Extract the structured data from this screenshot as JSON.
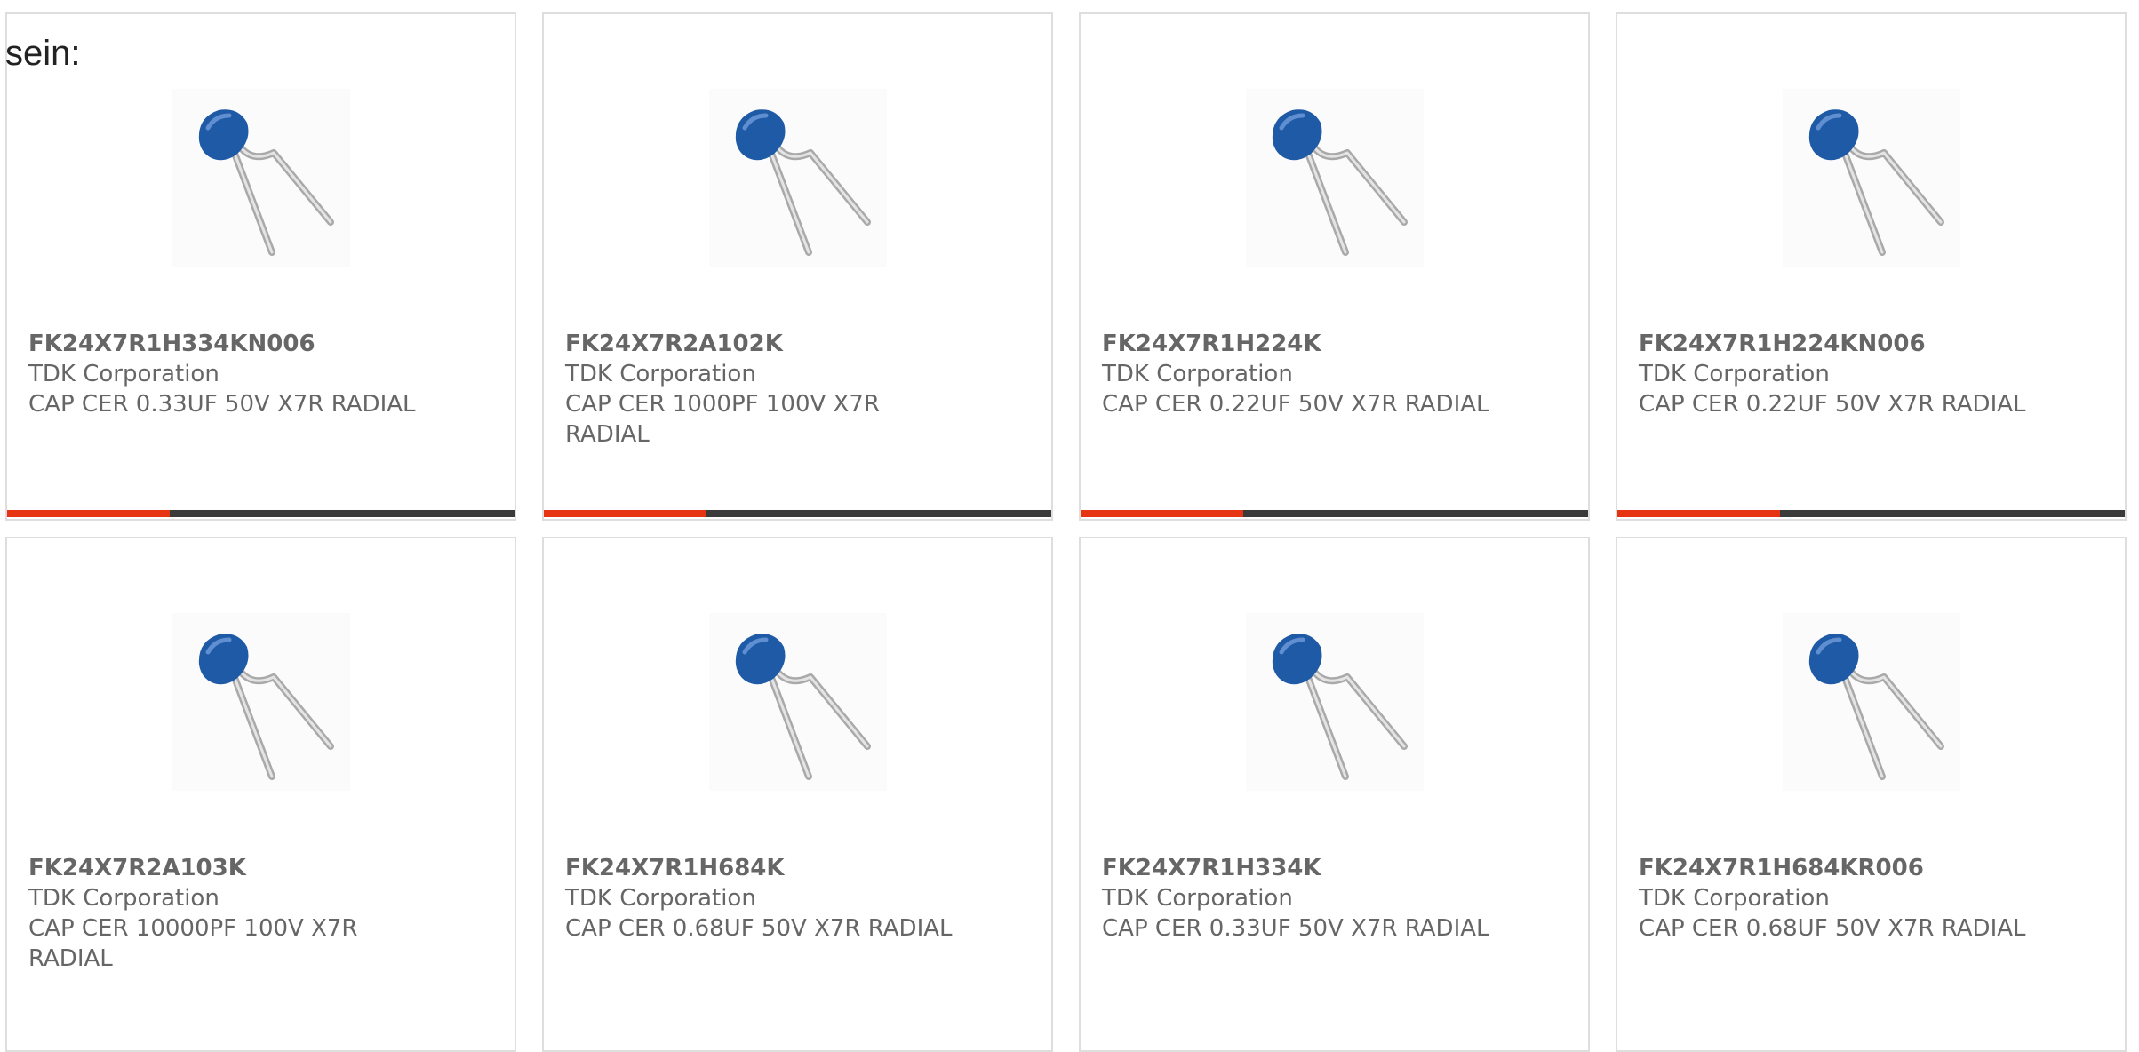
{
  "intro_text": "sein:",
  "colors": {
    "accent": "#e63312",
    "bar_track": "#3a3a3a",
    "capacitor_body": "#1f5aa6"
  },
  "products": [
    {
      "part_number": "FK24X7R1H334KN006",
      "manufacturer": "TDK Corporation",
      "description": "CAP CER 0.33UF 50V X7R RADIAL",
      "image_icon": "ceramic-capacitor-icon",
      "progress": 0.32
    },
    {
      "part_number": "FK24X7R2A102K",
      "manufacturer": "TDK Corporation",
      "description": "CAP CER 1000PF 100V X7R RADIAL",
      "image_icon": "ceramic-capacitor-icon",
      "progress": 0.32
    },
    {
      "part_number": "FK24X7R1H224K",
      "manufacturer": "TDK Corporation",
      "description": "CAP CER 0.22UF 50V X7R RADIAL",
      "image_icon": "ceramic-capacitor-icon",
      "progress": 0.32
    },
    {
      "part_number": "FK24X7R1H224KN006",
      "manufacturer": "TDK Corporation",
      "description": "CAP CER 0.22UF 50V X7R RADIAL",
      "image_icon": "ceramic-capacitor-icon",
      "progress": 0.32
    },
    {
      "part_number": "FK24X7R2A103K",
      "manufacturer": "TDK Corporation",
      "description": "CAP CER 10000PF 100V X7R RADIAL",
      "image_icon": "ceramic-capacitor-icon",
      "progress": 0.32
    },
    {
      "part_number": "FK24X7R1H684K",
      "manufacturer": "TDK Corporation",
      "description": "CAP CER 0.68UF 50V X7R RADIAL",
      "image_icon": "ceramic-capacitor-icon",
      "progress": 0.32
    },
    {
      "part_number": "FK24X7R1H334K",
      "manufacturer": "TDK Corporation",
      "description": "CAP CER 0.33UF 50V X7R RADIAL",
      "image_icon": "ceramic-capacitor-icon",
      "progress": 0.32
    },
    {
      "part_number": "FK24X7R1H684KR006",
      "manufacturer": "TDK Corporation",
      "description": "CAP CER 0.68UF 50V X7R RADIAL",
      "image_icon": "ceramic-capacitor-icon",
      "progress": 0.32
    }
  ]
}
